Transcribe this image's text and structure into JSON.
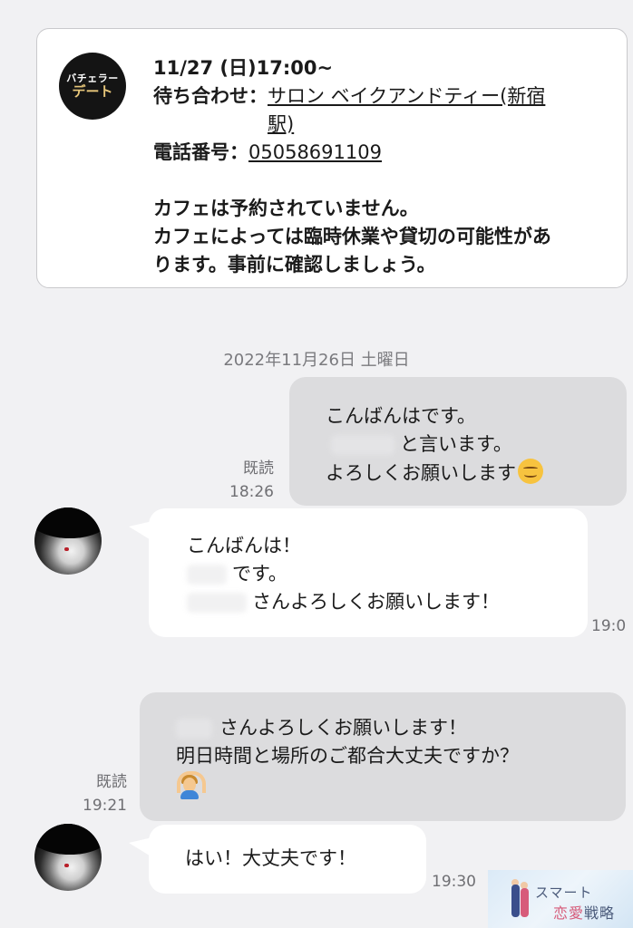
{
  "info_card": {
    "logo_line1": "バチェラー",
    "logo_line2": "デート",
    "datetime": "11/27 (日)17:00~",
    "meeting_label": "待ち合わせ：",
    "meeting_place_line1": "サロン ベイクアンドティー(新宿",
    "meeting_place_line2": "駅)",
    "phone_label": "電話番号：",
    "phone_number": "05058691109",
    "note_line1": "カフェは予約されていません。",
    "note_line2": "カフェによっては臨時休業や貸切の可能性があ",
    "note_line3": "ります。事前に確認しましょう。"
  },
  "date_separator": "2022年11月26日 土曜日",
  "messages": [
    {
      "direction": "outgoing",
      "lines": [
        "こんばんはです。",
        "と言います。",
        "よろしくお願いします"
      ],
      "emoji": "smiling-face-icon",
      "read_label": "既読",
      "time": "18:26"
    },
    {
      "direction": "incoming",
      "lines": [
        "こんばんは！",
        "です。",
        "さんよろしくお願いします！"
      ],
      "time": "19:0"
    },
    {
      "direction": "outgoing",
      "lines": [
        "さんよろしくお願いします！",
        "明日時間と場所のご都合大丈夫ですか？"
      ],
      "emoji": "person-gesturing-ok-icon",
      "read_label": "既読",
      "time": "19:21"
    },
    {
      "direction": "incoming",
      "lines": [
        "はい！大丈夫です！"
      ],
      "time": "19:30"
    }
  ],
  "watermark": {
    "line1": "スマート",
    "line2_pink": "恋愛",
    "line2_rest": "戦略"
  },
  "colors": {
    "background": "#f1f1f3",
    "outgoing_bubble": "#dcdcde",
    "incoming_bubble": "#ffffff",
    "meta_text": "#6f6f73"
  }
}
